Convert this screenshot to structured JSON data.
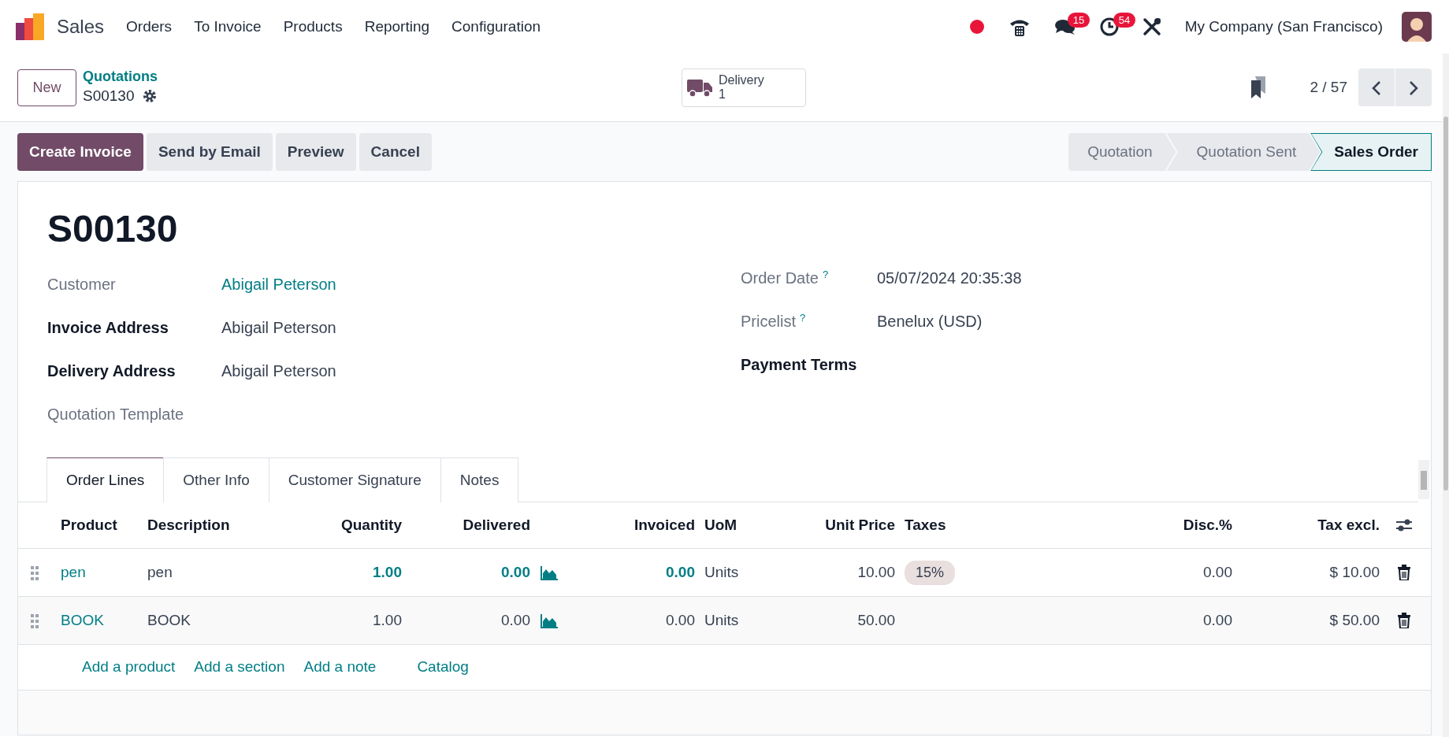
{
  "navbar": {
    "app_name": "Sales",
    "menu": [
      "Orders",
      "To Invoice",
      "Products",
      "Reporting",
      "Configuration"
    ],
    "systray": [
      {
        "kind": "record"
      },
      {
        "kind": "phone"
      },
      {
        "kind": "chat",
        "badge": "15"
      },
      {
        "kind": "activity",
        "badge": "54"
      },
      {
        "kind": "tools"
      }
    ],
    "company": "My Company (San Francisco)"
  },
  "control_panel": {
    "new_button": "New",
    "breadcrumb": "Quotations",
    "record_name": "S00130",
    "smart_button": {
      "label": "Delivery",
      "count": "1"
    },
    "pager": "2 / 57"
  },
  "actions": [
    {
      "label": "Create Invoice",
      "primary": true
    },
    {
      "label": "Send by Email",
      "primary": false
    },
    {
      "label": "Preview",
      "primary": false
    },
    {
      "label": "Cancel",
      "primary": false
    }
  ],
  "stages": [
    {
      "label": "Quotation",
      "selected": false
    },
    {
      "label": "Quotation Sent",
      "selected": false
    },
    {
      "label": "Sales Order",
      "selected": true
    }
  ],
  "form": {
    "title": "S00130",
    "left_fields": [
      {
        "label": "Customer",
        "value": "Abigail Peterson",
        "link": true,
        "required": false
      },
      {
        "label": "Invoice Address",
        "value": "Abigail Peterson",
        "link": false,
        "required": true
      },
      {
        "label": "Delivery Address",
        "value": "Abigail Peterson",
        "link": false,
        "required": true
      },
      {
        "label": "Quotation Template",
        "required": false
      }
    ],
    "right_fields": [
      {
        "label": "Order Date",
        "help": "?",
        "value": "05/07/2024 20:35:38",
        "link": false,
        "required": false
      },
      {
        "label": "Pricelist",
        "help": "?",
        "value": "Benelux (USD)",
        "link": false,
        "required": false
      },
      {
        "label": "Payment Terms",
        "required": true
      }
    ]
  },
  "tabs": [
    {
      "label": "Order Lines",
      "selected": true
    },
    {
      "label": "Other Info",
      "selected": false
    },
    {
      "label": "Customer Signature",
      "selected": false
    },
    {
      "label": "Notes",
      "selected": false
    }
  ],
  "table": {
    "columns": [
      "Product",
      "Description",
      "Quantity",
      "Delivered",
      "Invoiced",
      "UoM",
      "Unit Price",
      "Taxes",
      "Disc.%",
      "Tax excl."
    ],
    "rows": [
      {
        "product": "pen",
        "description": "pen",
        "quantity": "1.00",
        "delivered": "0.00",
        "invoiced": "0.00",
        "uom": "Units",
        "unit_price": "10.00",
        "taxes": [
          "15%"
        ],
        "discount": "0.00",
        "subtotal": "$ 10.00",
        "highlighted": true
      },
      {
        "product": "BOOK",
        "description": "BOOK",
        "quantity": "1.00",
        "delivered": "0.00",
        "invoiced": "0.00",
        "uom": "Units",
        "unit_price": "50.00",
        "taxes": [],
        "discount": "0.00",
        "subtotal": "$ 50.00",
        "highlighted": false
      }
    ],
    "add_links": [
      "Add a product",
      "Add a section",
      "Add a note",
      "Catalog"
    ]
  }
}
